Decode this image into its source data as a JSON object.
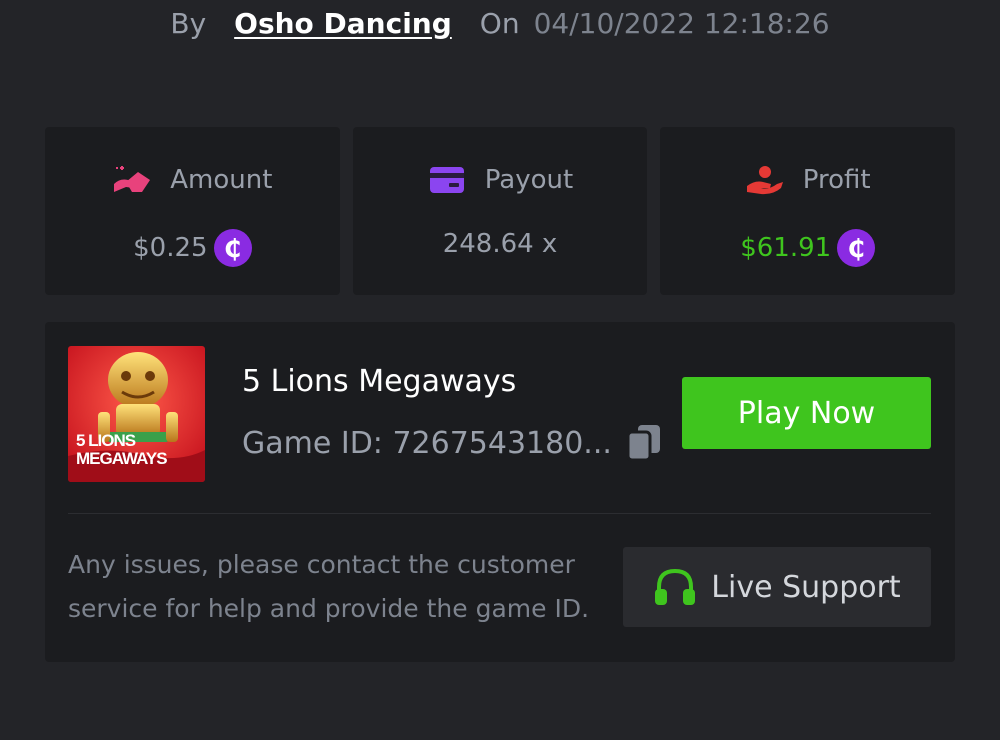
{
  "byline": {
    "by_label": "By",
    "user": "Osho Dancing",
    "on_label": "On",
    "date": "04/10/2022 12:18:26"
  },
  "stats": {
    "amount": {
      "label": "Amount",
      "value": "$0.25",
      "icon": "hand-coin-icon",
      "color": "#e8427c"
    },
    "payout": {
      "label": "Payout",
      "value": "248.64 x",
      "icon": "card-icon",
      "color": "#8b45f0"
    },
    "profit": {
      "label": "Profit",
      "value": "$61.91",
      "icon": "hand-heart-icon",
      "color": "#e53935",
      "value_color": "#3fc51e"
    }
  },
  "coin_symbol": "₵",
  "game": {
    "title": "5 Lions Megaways",
    "id_label": "Game ID: 7267543180...",
    "thumb_text_line1": "5 LIONS",
    "thumb_text_line2": "MEGAWAYS",
    "play_label": "Play Now"
  },
  "support": {
    "help_text": "Any issues, please contact the customer service for help and provide the game ID.",
    "button_label": "Live Support"
  },
  "colors": {
    "background": "#232428",
    "card": "#1b1c1f",
    "accent_green": "#3fc51e",
    "coin_purple": "#8a2be2"
  }
}
